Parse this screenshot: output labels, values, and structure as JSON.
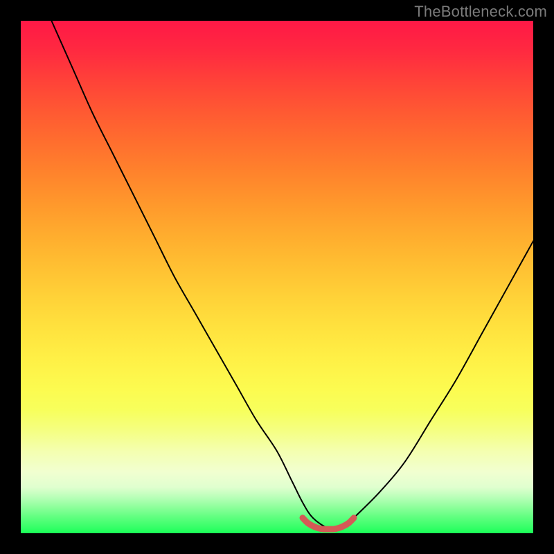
{
  "watermark": "TheBottleneck.com",
  "colors": {
    "background": "#000000",
    "curve_main": "#000000",
    "curve_highlight": "#d45a56",
    "gradient_top": "#ff1846",
    "gradient_bottom": "#18ff55"
  },
  "chart_data": {
    "type": "line",
    "title": "",
    "xlabel": "",
    "ylabel": "",
    "xlim": [
      0,
      100
    ],
    "ylim": [
      0,
      100
    ],
    "grid": false,
    "legend": false,
    "series": [
      {
        "name": "bottleneck-curve",
        "x": [
          6,
          10,
          14,
          18,
          22,
          26,
          30,
          34,
          38,
          42,
          46,
          50,
          53,
          55,
          57,
          60,
          63,
          65,
          70,
          75,
          80,
          85,
          90,
          95,
          100
        ],
        "y": [
          100,
          91,
          82,
          74,
          66,
          58,
          50,
          43,
          36,
          29,
          22,
          16,
          10,
          6,
          3,
          1,
          1,
          3,
          8,
          14,
          22,
          30,
          39,
          48,
          57
        ]
      },
      {
        "name": "optimal-range-highlight",
        "x": [
          55,
          56,
          57,
          58,
          59,
          60,
          61,
          62,
          63,
          64,
          65
        ],
        "y": [
          3.0,
          2.0,
          1.4,
          1.0,
          0.8,
          0.8,
          0.8,
          1.0,
          1.4,
          2.0,
          3.0
        ]
      }
    ]
  }
}
